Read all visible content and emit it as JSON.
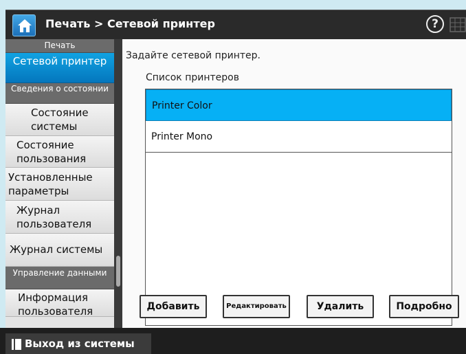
{
  "header": {
    "title": "Печать > Сетевой принтер",
    "home_icon": "home-icon",
    "help_label": "?",
    "grid_icon": "grid-icon"
  },
  "sidebar": {
    "groups": [
      {
        "label": "Печать"
      },
      {
        "label": "Сведения о состоянии"
      },
      {
        "label": "Управление данными"
      }
    ],
    "items": [
      {
        "label": "Сетевой принтер",
        "active": true
      },
      {
        "label": "Состояние системы"
      },
      {
        "label": "Состояние пользования"
      },
      {
        "label": "Установленные параметры"
      },
      {
        "label": "Журнал пользователя"
      },
      {
        "label": "Журнал системы"
      },
      {
        "label": "Информация пользователя"
      }
    ]
  },
  "main": {
    "instruction": "Задайте сетевой принтер.",
    "list_caption": "Список принтеров",
    "printers": [
      {
        "name": "Printer Color",
        "selected": true
      },
      {
        "name": "Printer Mono"
      }
    ],
    "buttons": {
      "add": "Добавить",
      "edit": "Редактировать",
      "delete": "Удалить",
      "details": "Подробно"
    }
  },
  "footer": {
    "logout_label": "Выход из системы",
    "logout_icon": "book-icon"
  },
  "colors": {
    "accent": "#0a8fd6",
    "selected_row": "#06b0f5",
    "header_bg": "#2a2a2a"
  }
}
